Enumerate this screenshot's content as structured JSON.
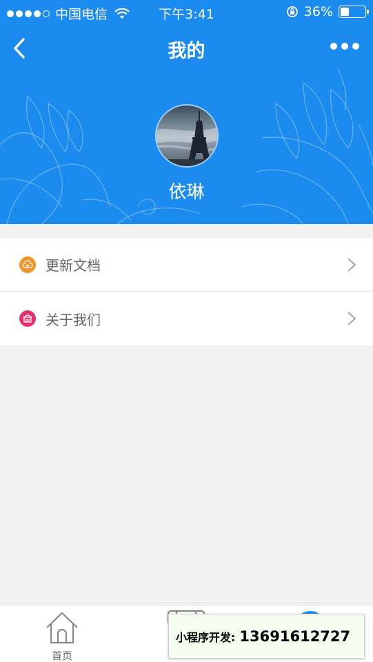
{
  "status_bar": {
    "carrier": "中国电信",
    "time": "下午3:41",
    "battery": "36%",
    "battery_level": 0.36,
    "signal_dots_filled": 4
  },
  "nav": {
    "title": "我的"
  },
  "profile": {
    "username": "依琳"
  },
  "menu": {
    "items": [
      {
        "label": "更新文档",
        "icon": "cloud-upload-icon",
        "color": "#f0952b"
      },
      {
        "label": "关于我们",
        "icon": "building-icon",
        "color": "#e2336f"
      }
    ]
  },
  "tabbar": {
    "tabs": [
      {
        "label": "首页",
        "icon": "home-icon"
      },
      {
        "label": "",
        "icon": "list-icon"
      },
      {
        "label": "",
        "icon": "profile-icon"
      }
    ]
  },
  "overlay": {
    "label": "小程序开发:",
    "phone": "13691612727"
  },
  "colors": {
    "header_bg": "#1b8bf0",
    "page_bg": "#f1f1f1"
  }
}
